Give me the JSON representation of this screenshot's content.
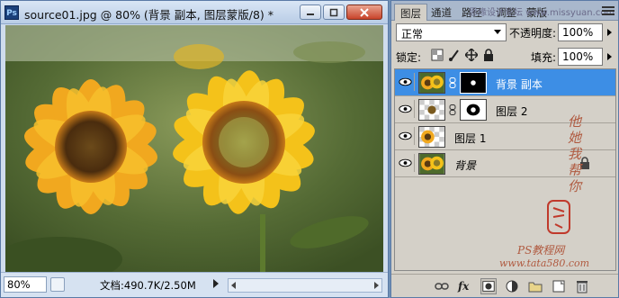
{
  "document": {
    "app_icon": "Ps",
    "title": "source01.jpg @ 80% (背景 副本, 图层蒙版/8) *",
    "window_buttons": [
      "minimize-icon",
      "restore-icon",
      "close-icon"
    ],
    "zoom": "80%",
    "doc_size": "文档:490.7K/2.50M"
  },
  "panel": {
    "tabs": [
      {
        "label": "图层",
        "active": true
      },
      {
        "label": "通道",
        "active": false
      },
      {
        "label": "路径",
        "active": false
      },
      {
        "label": "调整",
        "active": false
      },
      {
        "label": "蒙版",
        "active": false
      }
    ],
    "tab_overlay_text": "思缘设计论坛 www.missyuan.com",
    "blend_mode": "正常",
    "opacity_label": "不透明度:",
    "opacity": "100%",
    "lock_label": "锁定:",
    "fill_label": "填充:",
    "fill": "100%",
    "layers": [
      {
        "name": "背景 副本",
        "selected": true,
        "has_mask": true,
        "visible": true
      },
      {
        "name": "图层 2",
        "selected": false,
        "has_mask": true,
        "visible": true
      },
      {
        "name": "图层 1",
        "selected": false,
        "has_mask": false,
        "visible": true
      },
      {
        "name": "背景",
        "selected": false,
        "has_mask": false,
        "visible": true,
        "locked": true
      }
    ],
    "bottom_icons": [
      "link-layers-icon",
      "fx-icon",
      "add-mask-icon",
      "adjustment-icon",
      "new-group-icon",
      "new-layer-icon",
      "delete-icon"
    ]
  },
  "watermark": {
    "vertical_text": "他她我帮你",
    "site_line1": "PS教程网",
    "site_line2": "www.tata580.com"
  },
  "colors": {
    "selection": "#3d8ee5",
    "panel_bg": "#d4d0c8",
    "title_bar": "#c7d7ec"
  }
}
